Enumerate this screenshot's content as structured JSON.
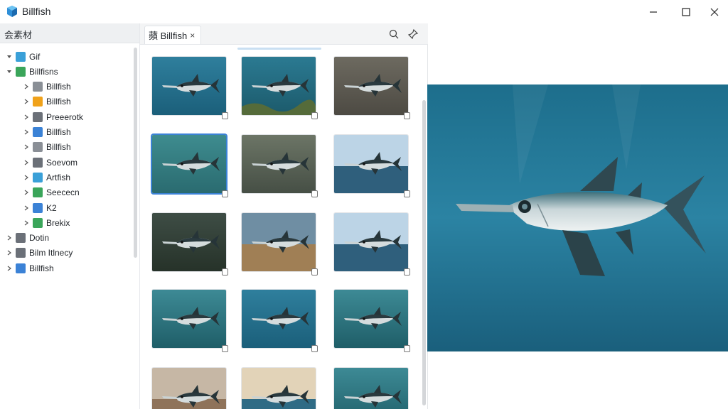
{
  "app": {
    "title": "Billfish"
  },
  "sidebar": {
    "header": "会素材",
    "items": [
      {
        "label": "Gif",
        "icon": "gif-icon",
        "color": "#3aa0d8",
        "expanded": true,
        "level": 0
      },
      {
        "label": "Billfisns",
        "icon": "folder-green-icon",
        "color": "#3aa55a",
        "expanded": true,
        "level": 0
      },
      {
        "label": "Billfish",
        "icon": "fish-icon",
        "color": "#8a8f96",
        "level": 1
      },
      {
        "label": "Billfish",
        "icon": "folder-orange-icon",
        "color": "#f0a21a",
        "level": 1
      },
      {
        "label": "Preeerotk",
        "icon": "gear-icon",
        "color": "#6b7078",
        "level": 1
      },
      {
        "label": "Billfish",
        "icon": "image-blue-icon",
        "color": "#3b82d6",
        "level": 1
      },
      {
        "label": "Billfish",
        "icon": "list-icon",
        "color": "#8a8f96",
        "level": 1
      },
      {
        "label": "Soevom",
        "icon": "grid-icon",
        "color": "#6b7078",
        "level": 1
      },
      {
        "label": "Artfish",
        "icon": "fish-blue-icon",
        "color": "#3aa0d8",
        "level": 1
      },
      {
        "label": "Seececn",
        "icon": "doc-green-icon",
        "color": "#3aa55a",
        "level": 1
      },
      {
        "label": "K2",
        "icon": "bookmark-blue-icon",
        "color": "#3b82d6",
        "level": 1
      },
      {
        "label": "Brekix",
        "icon": "check-green-icon",
        "color": "#3aa55a",
        "level": 1
      },
      {
        "label": "Dotin",
        "icon": "back-arrow-icon",
        "color": "#6b7078",
        "level": 0
      },
      {
        "label": "Bilm Itlnecy",
        "icon": "star-icon",
        "color": "#6b7078",
        "level": 0
      },
      {
        "label": "Billfish",
        "icon": "plus-icon",
        "color": "#3b82d6",
        "level": 0
      }
    ]
  },
  "tabs": [
    {
      "label": "蘋 Billfish",
      "close": "×"
    }
  ],
  "toolbar": {
    "search_icon": "search-icon",
    "pin_icon": "pin-icon"
  },
  "grid": {
    "thumbnails": [
      {
        "scene": "ocean",
        "selected": false
      },
      {
        "scene": "reef",
        "selected": false
      },
      {
        "scene": "rock",
        "selected": false
      },
      {
        "scene": "bubbles",
        "selected": true
      },
      {
        "scene": "murky",
        "selected": false
      },
      {
        "scene": "sea-sky",
        "selected": false
      },
      {
        "scene": "dark-green",
        "selected": false
      },
      {
        "scene": "sand",
        "selected": false
      },
      {
        "scene": "sea-sky",
        "selected": false
      },
      {
        "scene": "teal",
        "selected": false
      },
      {
        "scene": "ocean",
        "selected": false
      },
      {
        "scene": "teal",
        "selected": false
      },
      {
        "scene": "beach",
        "selected": false
      },
      {
        "scene": "sunset-sea",
        "selected": false
      },
      {
        "scene": "teal",
        "selected": false
      }
    ]
  },
  "colors": {
    "accent": "#3b82d6",
    "preview_water": "#1f6f8f"
  }
}
